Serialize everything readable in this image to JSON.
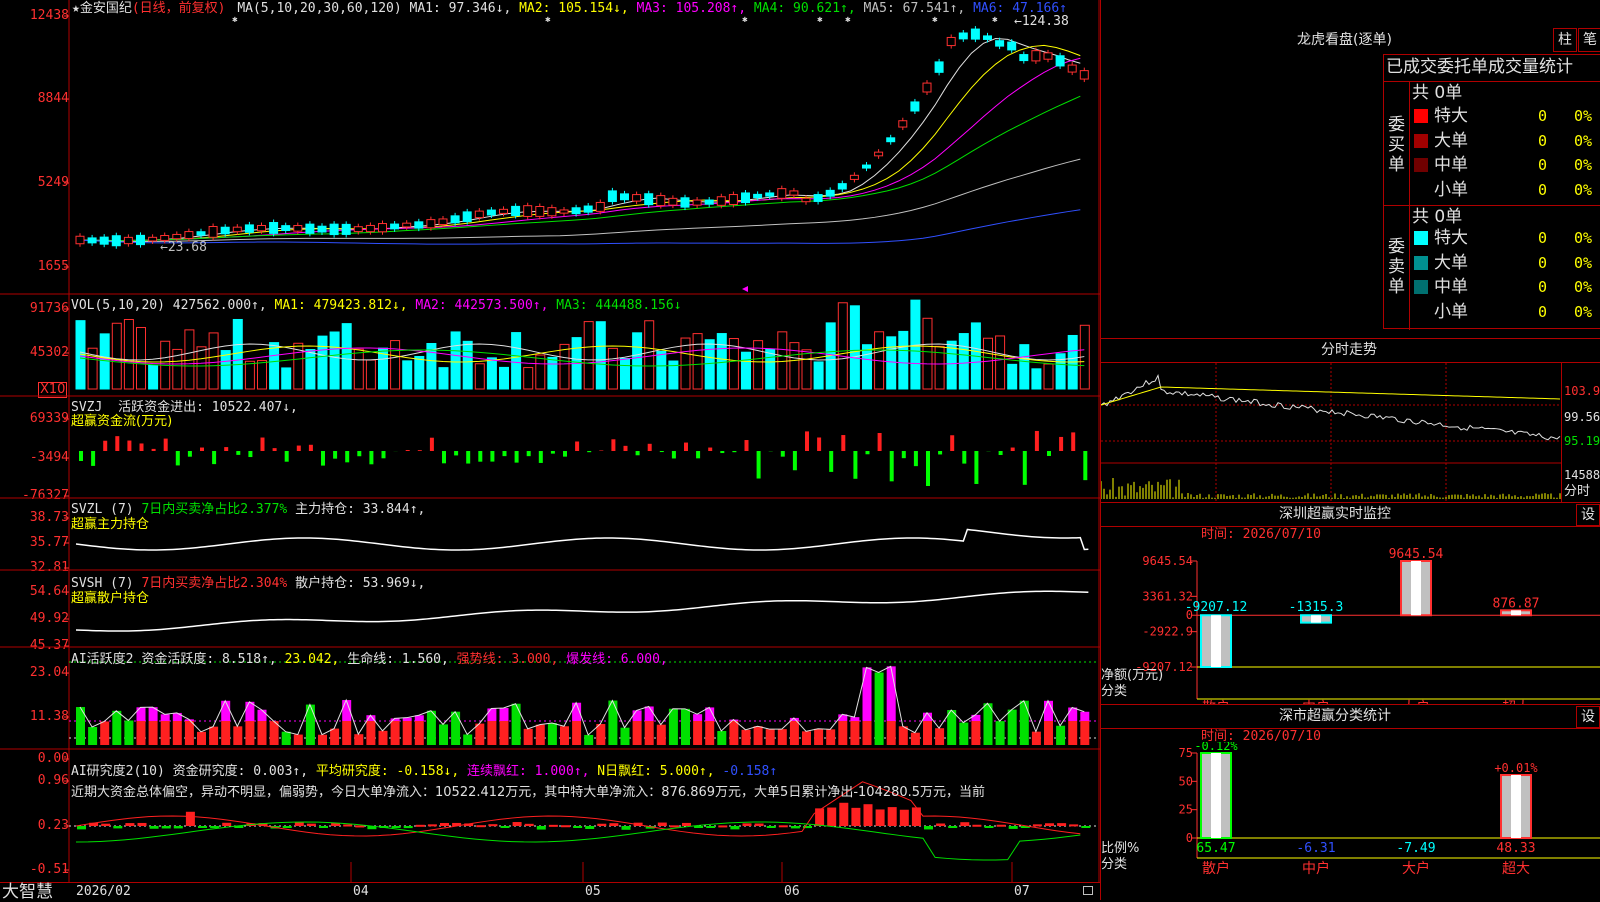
{
  "left_axis": {
    "price": [
      "12438",
      "8844",
      "5249",
      "1655"
    ],
    "vol": [
      "91736",
      "45302"
    ],
    "vol_mult": "X10",
    "svzj": [
      "69339",
      "-3494",
      "-76327"
    ],
    "svzl": [
      "38.73",
      "35.77",
      "32.81"
    ],
    "svsh": [
      "54.64",
      "49.92",
      "45.37"
    ],
    "ai_act": [
      "23.04",
      "11.38",
      "0.00"
    ],
    "ai_res": [
      "0.96",
      "0.23",
      "-0.51"
    ]
  },
  "main_header": {
    "star": "★",
    "stock_name": "金安国纪",
    "period": "(日线，前复权)",
    "ma_param": "MA(5,10,20,30,60,120)",
    "ma1": "MA1: 97.346↓,",
    "ma2": "MA2: 105.154↓,",
    "ma3": "MA3: 105.208↑,",
    "ma4": "MA4: 90.621↑,",
    "ma5": "MA5: 67.541↑,",
    "ma6": "MA6: 47.166↑"
  },
  "price_marks": {
    "high": "124.38",
    "low": "23.68"
  },
  "vol_header": {
    "param": "VOL(5,10,20)",
    "vol": "427562.000↑,",
    "ma1": "MA1: 479423.812↓,",
    "ma2": "MA2: 442573.500↑,",
    "ma3": "MA3: 444488.156↓"
  },
  "svzj_header": {
    "name": "SVZJ",
    "text": "活跃资金进出: 10522.407↓,",
    "sub": "超赢资金流(万元)"
  },
  "svzl_header": {
    "name": "SVZL (7)",
    "text1": "7日内买卖净占比2.377%",
    "text2": "主力持仓: 33.844↑,",
    "sub": "超赢主力持仓"
  },
  "svsh_header": {
    "name": "SVSH (7)",
    "text1": "7日内买卖净占比2.304%",
    "text2": "散户持仓: 53.969↓,",
    "sub": "超赢散户持仓"
  },
  "ai_act_header": {
    "name": "AI活跃度2",
    "t1": "资金活跃度: 8.518↑,",
    "t2": "23.042,",
    "t3": "生命线: 1.560,",
    "t4": "强势线: 3.000,",
    "t5": "爆发线: 6.000,"
  },
  "ai_res_header": {
    "name": "AI研究度2(10)",
    "t1": "资金研究度: 0.003↑,",
    "t2": "平均研究度: -0.158↓,",
    "t3": "连续飘红: 1.000↑,",
    "t4": "N日飘红: 5.000↑,",
    "t5": "-0.158↑",
    "summary": "近期大资金总体偏空，异动不明显，偏弱势，今日大单净流入：10522.412万元，其中特大单净流入：876.869万元，大单5日累计净出-104280.5万元，当前"
  },
  "bottom_bar": {
    "brand": "大智慧",
    "dates": [
      "2026/02",
      "04",
      "05",
      "06",
      "07"
    ]
  },
  "longhu": {
    "title": "龙虎看盘(逐单)",
    "btn_zhu": "柱",
    "btn_bi": "笔",
    "tabs": "已成交委托单成交量统计",
    "buy_side": "委买单",
    "sell_side": "委卖单",
    "buy_total": "共 0单",
    "sell_total": "共 0单",
    "buy_rows": [
      {
        "label": "特大",
        "count": "0",
        "pct": "0%",
        "color": "#ff0000"
      },
      {
        "label": "大单",
        "count": "0",
        "pct": "0%",
        "color": "#a00000"
      },
      {
        "label": "中单",
        "count": "0",
        "pct": "0%",
        "color": "#700000"
      },
      {
        "label": "小单",
        "count": "0",
        "pct": "0%",
        "color": ""
      }
    ],
    "sell_rows": [
      {
        "label": "特大",
        "count": "0",
        "pct": "0%",
        "color": "#00ffff"
      },
      {
        "label": "大单",
        "count": "0",
        "pct": "0%",
        "color": "#009090"
      },
      {
        "label": "中单",
        "count": "0",
        "pct": "0%",
        "color": "#007070"
      },
      {
        "label": "小单",
        "count": "0",
        "pct": "0%",
        "color": ""
      }
    ]
  },
  "fenshi": {
    "title": "分时走势",
    "prices": [
      "103.9",
      "99.56",
      "95.19"
    ],
    "vol": "14588",
    "vol_label": "分时"
  },
  "shenzhen_monitor": {
    "title": "深圳超赢实时监控",
    "btn": "设",
    "time_label": "时间: 2026/07/10",
    "y_axis": [
      "9645.54",
      "3361.32",
      "0",
      "-2922.9",
      "-9207.12"
    ],
    "y_label": "净额(万元)",
    "x_label": "分类",
    "categories": [
      "散户",
      "中户",
      "大户",
      "超大"
    ],
    "values": [
      -9207.12,
      -1315.3,
      9645.54,
      876.87
    ],
    "value_labels": [
      "-9207.12",
      "-1315.3",
      "9645.54",
      "876.87"
    ]
  },
  "shenzhen_stat": {
    "title": "深市超赢分类统计",
    "btn": "设",
    "time_label": "时间: 2026/07/10",
    "y_axis": [
      "75",
      "50",
      "25",
      "0"
    ],
    "y_label": "比例%",
    "x_label": "分类",
    "categories": [
      "散户",
      "中户",
      "大户",
      "超大"
    ],
    "values": [
      65.47,
      -6.31,
      -7.49,
      48.33
    ],
    "value_labels": [
      "65.47",
      "-6.31",
      "-7.49",
      "48.33"
    ],
    "change_labels": [
      "-0.12%",
      "",
      "",
      "+0.01%"
    ]
  },
  "chart_data": {
    "type": "bar",
    "title": "深圳超赢实时监控",
    "categories": [
      "散户",
      "中户",
      "大户",
      "超大"
    ],
    "values": [
      -9207.12,
      -1315.3,
      9645.54,
      876.87
    ],
    "ylabel": "净额(万元)",
    "xlabel": "分类",
    "ylim": [
      -9207.12,
      9645.54
    ]
  }
}
